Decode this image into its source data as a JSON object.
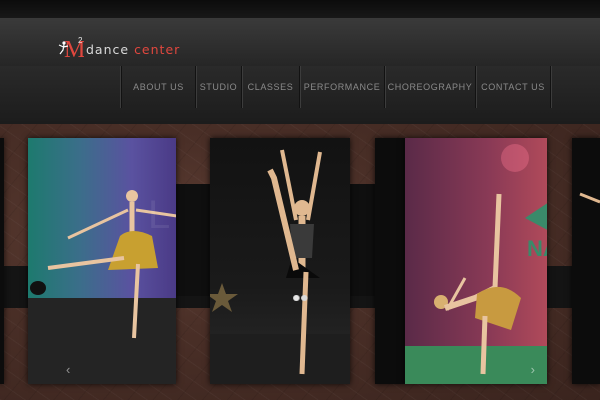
{
  "brand": {
    "logo_prefix": "M",
    "logo_sup": "2",
    "name_part1": "dance ",
    "name_part2": "center",
    "accent_color": "#e0473e"
  },
  "nav": {
    "items": [
      {
        "label": "About Us"
      },
      {
        "label": "Studio"
      },
      {
        "label": "Classes"
      },
      {
        "label": "Performance"
      },
      {
        "label": "Choreography"
      },
      {
        "label": "Contact Us"
      }
    ]
  },
  "slider": {
    "prev_icon": "chevron-left-icon",
    "next_icon": "chevron-right-icon",
    "prev_glyph": "‹",
    "next_glyph": "›",
    "banner_text": "NA"
  }
}
